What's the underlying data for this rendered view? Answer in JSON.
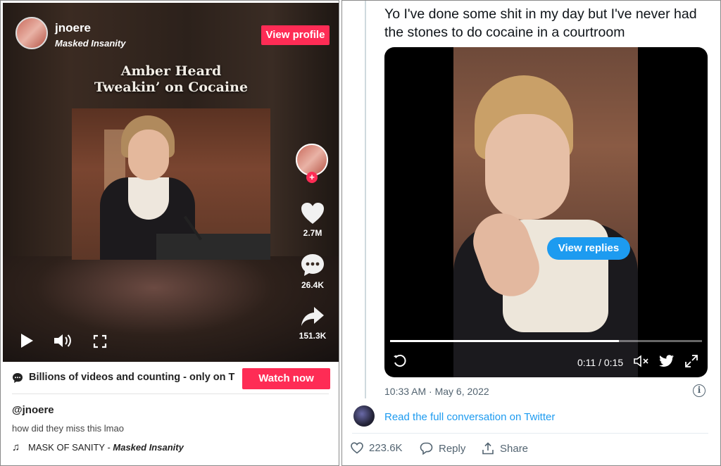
{
  "tiktok": {
    "username": "jnoere",
    "sound_name": "Masked Insanity",
    "view_profile_label": "View profile",
    "video_caption_line1": "Amber Heard",
    "video_caption_line2": "Tweakin’ on Cocaine",
    "likes": "2.7M",
    "comments": "26.4K",
    "shares": "151.3K",
    "banner_text": "Billions of videos and counting - only on T",
    "watch_now_label": "Watch now",
    "handle": "@jnoere",
    "description": "how did they miss this lmao",
    "music_track": "MASK OF SANITY - ",
    "music_artist": "Masked Insanity",
    "colors": {
      "accent": "#fe2c55"
    }
  },
  "tweet": {
    "text": "Yo I've done some shit in my day but I've never had the stones to do cocaine in a courtroom",
    "view_replies_label": "View replies",
    "video_time": "0:11 / 0:15",
    "video_progress": 0.733,
    "timestamp": "10:33 AM · May 6, 2022",
    "info_icon": "i",
    "conversation_link": "Read the full conversation on Twitter",
    "likes": "223.6K",
    "reply_label": "Reply",
    "share_label": "Share",
    "colors": {
      "accent": "#1d9bf0",
      "muted": "#536471"
    }
  }
}
